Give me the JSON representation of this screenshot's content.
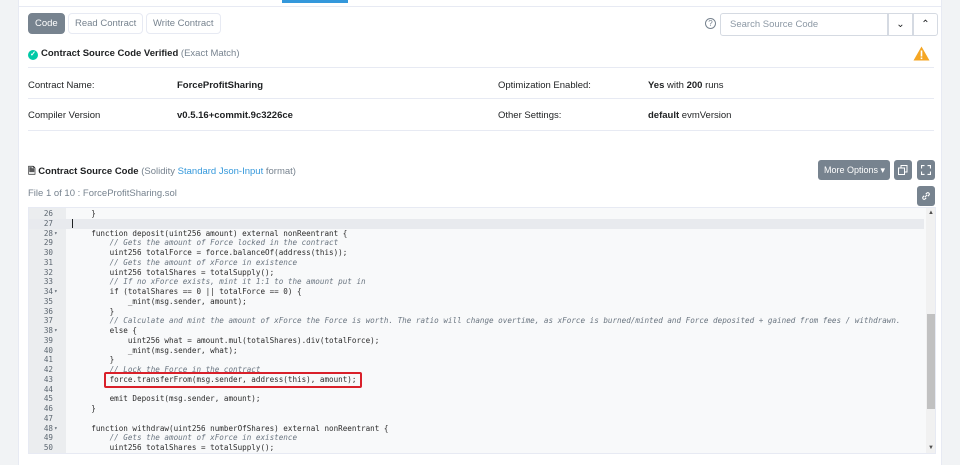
{
  "tabs": [
    "Code",
    "Read Contract",
    "Write Contract"
  ],
  "search": {
    "placeholder": "Search Source Code"
  },
  "verified": {
    "title": "Contract Source Code Verified",
    "match": "(Exact Match)"
  },
  "info": {
    "contract_name_label": "Contract Name:",
    "contract_name": "ForceProfitSharing",
    "compiler_label": "Compiler Version",
    "compiler": "v0.5.16+commit.9c3226ce",
    "optimization_label": "Optimization Enabled:",
    "optimization_yes": "Yes",
    "optimization_with": "with",
    "optimization_runs": "200",
    "optimization_runs_word": "runs",
    "other_label": "Other Settings:",
    "other_value": "default",
    "other_suffix": "evmVersion"
  },
  "source": {
    "title": "Contract Source Code",
    "paren_open": "(Solidity",
    "format_link": "Standard Json-Input",
    "paren_close": "format)",
    "more_options": "More Options",
    "file_info": "File 1 of 10 : ForceProfitSharing.sol"
  },
  "code_lines": [
    {
      "n": "26",
      "fold": "",
      "t": "    }"
    },
    {
      "n": "27",
      "fold": "",
      "t": ""
    },
    {
      "n": "28",
      "fold": "▾",
      "t": "    function deposit(uint256 amount) external nonReentrant {"
    },
    {
      "n": "29",
      "fold": "",
      "t": "        // Gets the amount of Force locked in the contract",
      "c": true
    },
    {
      "n": "30",
      "fold": "",
      "t": "        uint256 totalForce = force.balanceOf(address(this));"
    },
    {
      "n": "31",
      "fold": "",
      "t": "        // Gets the amount of xForce in existence",
      "c": true
    },
    {
      "n": "32",
      "fold": "",
      "t": "        uint256 totalShares = totalSupply();"
    },
    {
      "n": "33",
      "fold": "",
      "t": "        // If no xForce exists, mint it 1:1 to the amount put in",
      "c": true
    },
    {
      "n": "34",
      "fold": "▾",
      "t": "        if (totalShares == 0 || totalForce == 0) {"
    },
    {
      "n": "35",
      "fold": "",
      "t": "            _mint(msg.sender, amount);"
    },
    {
      "n": "36",
      "fold": "",
      "t": "        }"
    },
    {
      "n": "37",
      "fold": "",
      "t": "        // Calculate and mint the amount of xForce the Force is worth. The ratio will change overtime, as xForce is burned/minted and Force deposited + gained from fees / withdrawn.",
      "c": true
    },
    {
      "n": "38",
      "fold": "▾",
      "t": "        else {"
    },
    {
      "n": "39",
      "fold": "",
      "t": "            uint256 what = amount.mul(totalShares).div(totalForce);"
    },
    {
      "n": "40",
      "fold": "",
      "t": "            _mint(msg.sender, what);"
    },
    {
      "n": "41",
      "fold": "",
      "t": "        }"
    },
    {
      "n": "42",
      "fold": "",
      "t": "        // Lock the Force in the contract",
      "c": true
    },
    {
      "n": "43",
      "fold": "",
      "t": "        force.transferFrom(msg.sender, address(this), amount);"
    },
    {
      "n": "44",
      "fold": "",
      "t": ""
    },
    {
      "n": "45",
      "fold": "",
      "t": "        emit Deposit(msg.sender, amount);"
    },
    {
      "n": "46",
      "fold": "",
      "t": "    }"
    },
    {
      "n": "47",
      "fold": "",
      "t": ""
    },
    {
      "n": "48",
      "fold": "▾",
      "t": "    function withdraw(uint256 numberOfShares) external nonReentrant {"
    },
    {
      "n": "49",
      "fold": "",
      "t": "        // Gets the amount of xForce in existence",
      "c": true
    },
    {
      "n": "50",
      "fold": "",
      "t": "        uint256 totalShares = totalSupply();"
    }
  ],
  "colors": {
    "accent": "#3498db",
    "verified": "#00c9a7",
    "warning": "#f5a623",
    "highlight": "#d9202a"
  },
  "icons": {
    "help": "question-circle-icon",
    "warning": "warning-triangle-icon",
    "copy": "copy-icon",
    "fullscreen": "fullscreen-icon",
    "link": "link-icon"
  }
}
